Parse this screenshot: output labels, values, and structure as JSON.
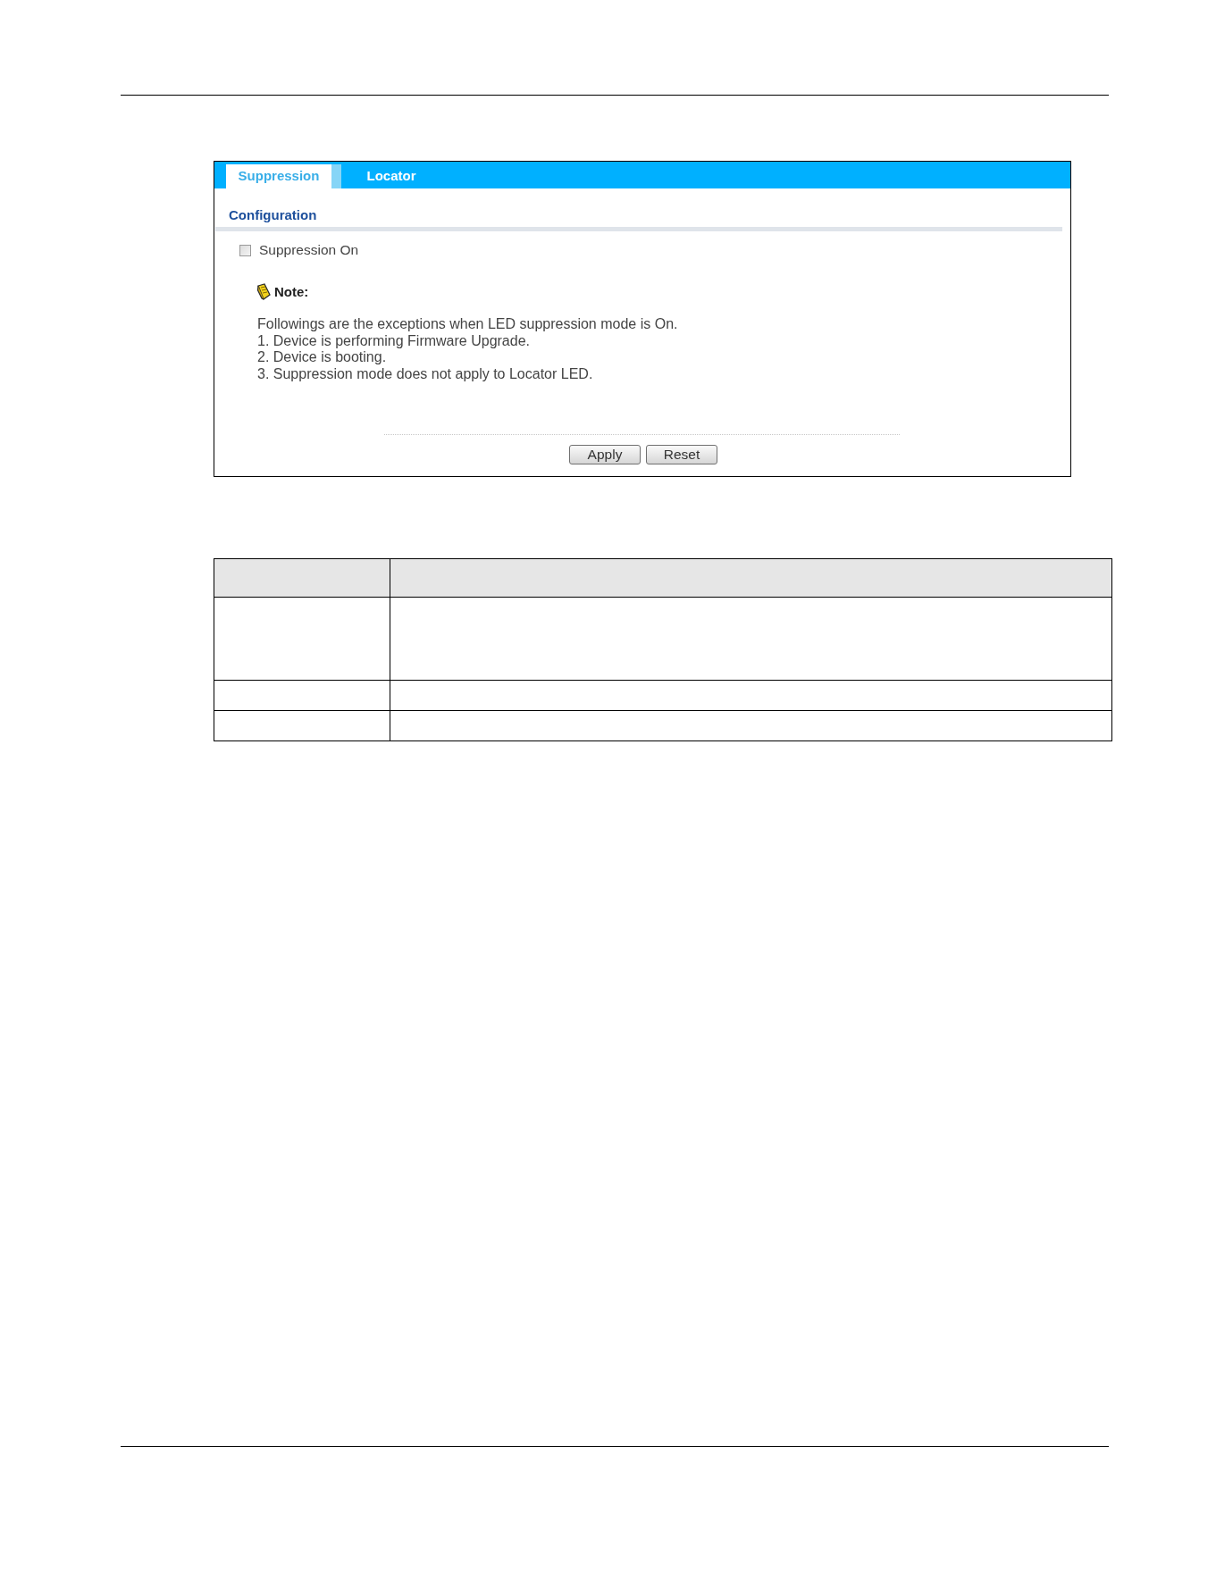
{
  "settings_panel": {
    "tabs": [
      {
        "label": "Suppression",
        "selected": true
      },
      {
        "label": "Locator",
        "selected": false
      }
    ],
    "section_title": "Configuration",
    "checkbox": {
      "label": "Suppression On",
      "checked": false
    },
    "note": {
      "title": "Note:",
      "lines": [
        "Followings are the exceptions when LED suppression mode is On.",
        "1. Device is performing Firmware Upgrade.",
        "2. Device is booting.",
        "3. Suppression mode does not apply to Locator LED."
      ]
    },
    "buttons": [
      "Apply",
      "Reset"
    ]
  },
  "table": {
    "rows": [
      {
        "kind": "header"
      },
      {
        "kind": "tall"
      },
      {
        "kind": "normal"
      },
      {
        "kind": "normal"
      }
    ]
  }
}
